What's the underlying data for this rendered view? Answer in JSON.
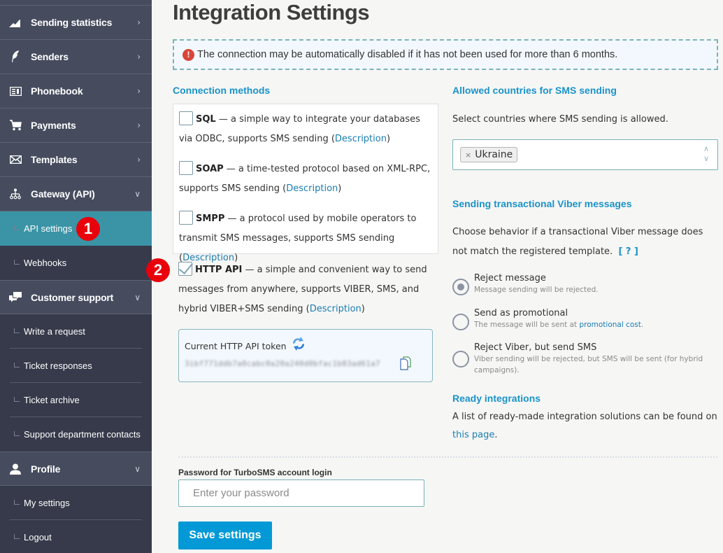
{
  "sidebar": {
    "items": [
      {
        "label": "Sending statistics",
        "icon": "chart-icon",
        "chevron": "right"
      },
      {
        "label": "Senders",
        "icon": "feather-icon",
        "chevron": "right"
      },
      {
        "label": "Phonebook",
        "icon": "contact-card-icon",
        "chevron": "right"
      },
      {
        "label": "Payments",
        "icon": "cart-icon",
        "chevron": "right"
      },
      {
        "label": "Templates",
        "icon": "envelope-icon",
        "chevron": "right"
      },
      {
        "label": "Gateway (API)",
        "icon": "network-icon",
        "chevron": "down",
        "children": [
          {
            "label": "API settings",
            "active": true
          },
          {
            "label": "Webhooks"
          }
        ]
      },
      {
        "label": "Customer support",
        "icon": "chat-icon",
        "chevron": "down",
        "children": [
          {
            "label": "Write a request"
          },
          {
            "label": "Ticket responses"
          },
          {
            "label": "Ticket archive"
          },
          {
            "label": "Support department contacts"
          }
        ]
      },
      {
        "label": "Profile",
        "icon": "user-icon",
        "chevron": "down",
        "children": [
          {
            "label": "My settings"
          },
          {
            "label": "Logout"
          }
        ]
      }
    ]
  },
  "annotations": {
    "badge1": "1",
    "badge2": "2"
  },
  "main": {
    "title": "Integration Settings",
    "alert": "The connection may be automatically disabled if it has not been used for more than 6 months.",
    "connection_methods": {
      "heading": "Connection methods",
      "methods": [
        {
          "name": "SQL",
          "desc": " — a simple way to integrate your databases via ODBC, supports SMS sending (",
          "link": "Description",
          "checked": false
        },
        {
          "name": "SOAP",
          "desc": " — a time-tested protocol based on XML-RPC, supports SMS sending (",
          "link": "Description",
          "checked": false
        },
        {
          "name": "SMPP",
          "desc": " — a protocol used by mobile operators to transmit SMS messages, supports SMS sending (",
          "link": "Description",
          "checked": false
        },
        {
          "name": "HTTP API",
          "desc": " — a simple and convenient way to send messages from anywhere, supports VIBER, SMS, and hybrid VIBER+SMS sending (",
          "link": "Description",
          "checked": true
        }
      ],
      "close_paren": ")",
      "token": {
        "label": "Current HTTP API token",
        "value": "3ibf771ddb7a0cabc0a20a240d0bfac1b83ad61a7"
      }
    },
    "countries": {
      "heading": "Allowed countries for SMS sending",
      "description": "Select countries where SMS sending is allowed.",
      "selected": [
        "Ukraine"
      ],
      "remove_glyph": "×"
    },
    "viber": {
      "heading": "Sending transactional Viber messages",
      "description": "Choose behavior if a transactional Viber message does not match the registered template.",
      "help_link": "[ ? ]",
      "options": [
        {
          "title": "Reject message",
          "desc": "Message sending will be rejected.",
          "selected": true
        },
        {
          "title": "Send as promotional",
          "desc_pre": "The message will be sent at ",
          "desc_link": "promotional cost",
          "desc_post": ".",
          "selected": false
        },
        {
          "title": "Reject Viber, but send SMS",
          "desc": "Viber sending will be rejected, but SMS will be sent (for hybrid campaigns).",
          "selected": false
        }
      ]
    },
    "ready": {
      "heading": "Ready integrations",
      "text_pre": "A list of ready-made integration solutions can be found on ",
      "link": "this page",
      "text_post": "."
    },
    "password": {
      "label": "Password for TurboSMS account login",
      "placeholder": "Enter your password",
      "value": ""
    },
    "save_label": "Save settings"
  },
  "colors": {
    "accent": "#1a93c8",
    "button": "#0399d6",
    "sidebar_bg": "#363a4a",
    "sidebar_main": "#464c5e",
    "active_item": "#3a94a6",
    "badge": "#e8000b"
  }
}
